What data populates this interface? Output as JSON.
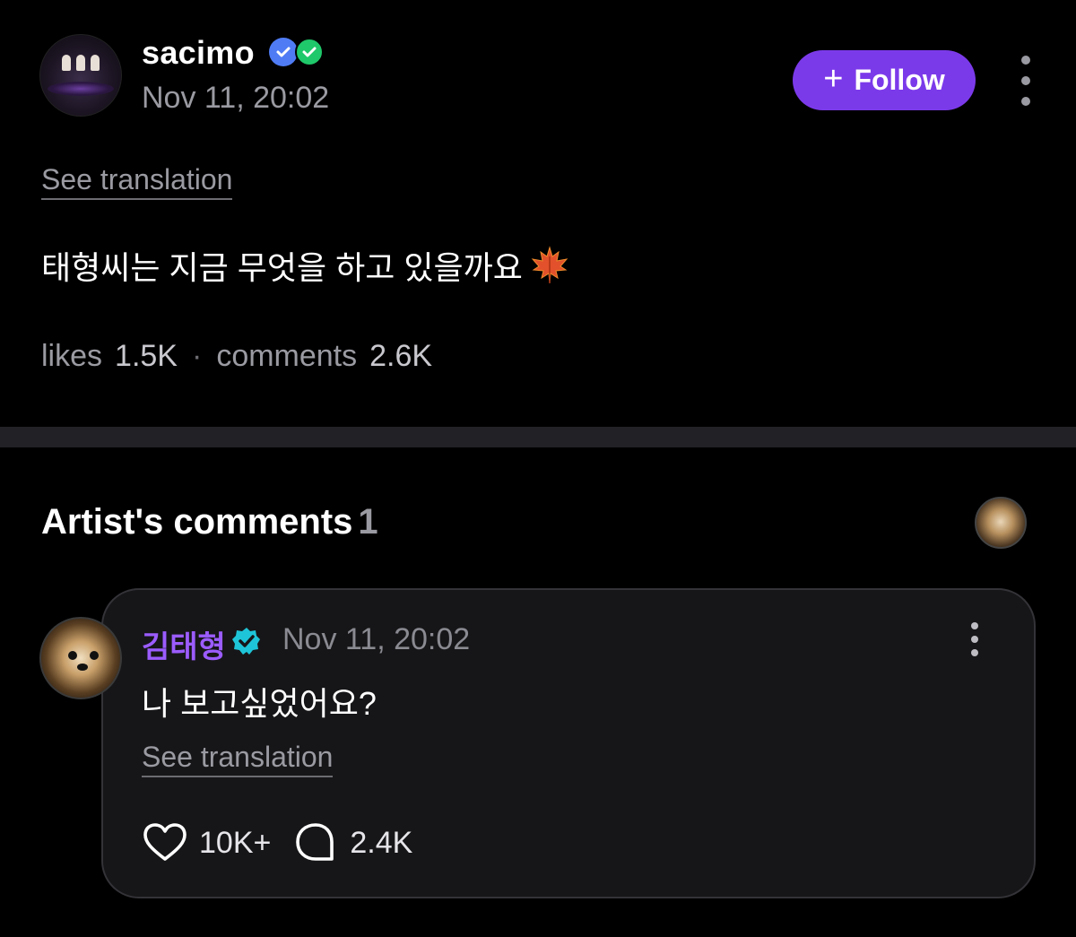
{
  "post": {
    "username": "sacimo",
    "date": "Nov 11, 20:02",
    "follow_label": "Follow",
    "see_translation": "See translation",
    "body": "태형씨는 지금 무엇을 하고 있을까요",
    "stats": {
      "likes_label": "likes",
      "likes_value": "1.5K",
      "separator": "·",
      "comments_label": "comments",
      "comments_value": "2.6K"
    }
  },
  "artist_comments": {
    "title": "Artist's comments",
    "count": "1",
    "comment": {
      "author": "김태형",
      "date": "Nov 11, 20:02",
      "body": "나 보고싶었어요?",
      "see_translation": "See translation",
      "likes": "10K+",
      "replies": "2.4K"
    }
  },
  "colors": {
    "accent": "#7b3aea",
    "artist_name": "#9b5cff",
    "badge_blue": "#4f7cf5",
    "badge_green": "#1fc86a",
    "verified": "#1ec5d8"
  },
  "icons": [
    "verified-badge-icon",
    "plus-icon",
    "more-vertical-icon",
    "maple-leaf-icon",
    "heart-icon",
    "comment-bubble-icon"
  ]
}
